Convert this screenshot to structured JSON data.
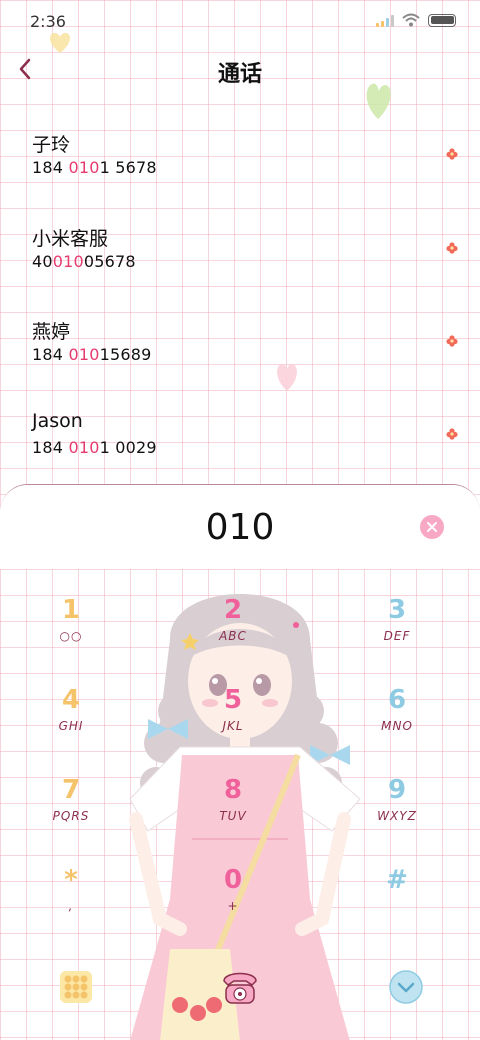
{
  "status_bar": {
    "time": "2:36"
  },
  "header": {
    "title": "通话"
  },
  "contacts": [
    {
      "name": "子玲",
      "number_pre": "184 ",
      "number_hl": "010",
      "number_post": "1 5678"
    },
    {
      "name": "小米客服",
      "number_pre": "40",
      "number_hl": "010",
      "number_post": "05678"
    },
    {
      "name": "燕婷",
      "number_pre": "184 ",
      "number_hl": "010",
      "number_post": "15689"
    },
    {
      "name": "Jason",
      "number_pre": "184 ",
      "number_hl": "010",
      "number_post": "1 0029"
    }
  ],
  "dialer": {
    "dialed_number": "010",
    "keys": [
      {
        "digit": "1",
        "letters": "○○",
        "color": "#f5c36a"
      },
      {
        "digit": "2",
        "letters": "ABC",
        "color": "#f0609a"
      },
      {
        "digit": "3",
        "letters": "DEF",
        "color": "#8ecbe3"
      },
      {
        "digit": "4",
        "letters": "GHI",
        "color": "#f5c36a"
      },
      {
        "digit": "5",
        "letters": "JKL",
        "color": "#f0609a"
      },
      {
        "digit": "6",
        "letters": "MNO",
        "color": "#8ecbe3"
      },
      {
        "digit": "7",
        "letters": "PQRS",
        "color": "#f5c36a"
      },
      {
        "digit": "8",
        "letters": "TUV",
        "color": "#f0609a"
      },
      {
        "digit": "9",
        "letters": "WXYZ",
        "color": "#8ecbe3"
      },
      {
        "digit": "*",
        "letters": ",",
        "color": "#f5c36a"
      },
      {
        "digit": "0",
        "letters": "+",
        "color": "#f0609a"
      },
      {
        "digit": "#",
        "letters": "",
        "color": "#8ecbe3"
      }
    ]
  },
  "colors": {
    "highlight": "#e63b6f",
    "grid": "#f0a0b4",
    "accent_pink": "#f0609a",
    "accent_yellow": "#f5c36a",
    "accent_blue": "#8ecbe3"
  },
  "icons": {
    "back": "chevron-left-icon",
    "clear": "close-circle-icon",
    "keypad": "grid-keypad-icon",
    "call": "telephone-icon",
    "collapse": "chevron-down-icon"
  }
}
